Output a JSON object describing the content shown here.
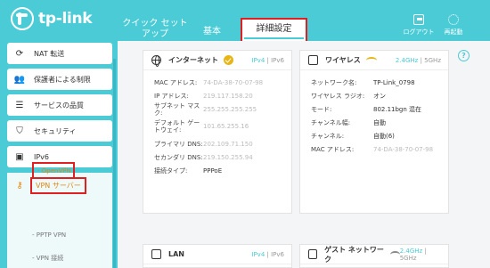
{
  "brand": {
    "name": "tp-link"
  },
  "header": {
    "tabs": [
      {
        "label": "クイック セット\nアップ"
      },
      {
        "label": "基本"
      },
      {
        "label": "詳細設定"
      }
    ],
    "logout_label": "ログアウト",
    "reboot_label": "再起動"
  },
  "sidebar": {
    "items": [
      {
        "label": "NAT 転送",
        "icon": "nat-icon"
      },
      {
        "label": "保護者による制限",
        "icon": "parental-icon"
      },
      {
        "label": "サービスの品質",
        "icon": "qos-icon"
      },
      {
        "label": "セキュリティ",
        "icon": "shield-icon"
      },
      {
        "label": "IPv6",
        "icon": "ipv6-icon"
      },
      {
        "label": "VPN サーバー",
        "icon": "key-icon"
      }
    ],
    "sub_items": [
      "- OpenVPN",
      "- PPTP VPN",
      "- VPN 接続"
    ]
  },
  "internet": {
    "title": "インターネット",
    "mode_ipv4": "IPv4",
    "sep": "|",
    "mode_ipv6": "IPv6",
    "rows": [
      {
        "label": "MAC アドレス:",
        "value": "74-DA-38-70-07-98"
      },
      {
        "label": "IP アドレス:",
        "value": "219.117.158.20"
      },
      {
        "label": "サブネット マスク:",
        "value": "255.255.255.255"
      },
      {
        "label": "デフォルト ゲートウェイ:",
        "value": "101.65.255.16"
      },
      {
        "label": "プライマリ DNS:",
        "value": "202.109.71.150"
      },
      {
        "label": "セカンダリ DNS:",
        "value": "219.150.255.94"
      },
      {
        "label": "接続タイプ:",
        "value": "PPPoE"
      }
    ]
  },
  "wireless": {
    "title": "ワイヤレス",
    "band1": "2.4GHz",
    "sep": "|",
    "band2": "5GHz",
    "rows": [
      {
        "label": "ネットワーク名:",
        "value": "TP-Link_0798"
      },
      {
        "label": "ワイヤレス ラジオ:",
        "value": "オン"
      },
      {
        "label": "モード:",
        "value": "802.11bgn 混在"
      },
      {
        "label": "チャンネル幅:",
        "value": "自動"
      },
      {
        "label": "チャンネル:",
        "value": "自動(6)"
      },
      {
        "label": "MAC アドレス:",
        "value": "74-DA-38-70-07-98"
      }
    ]
  },
  "lan": {
    "title": "LAN",
    "mode_ipv4": "IPv4",
    "sep": "|",
    "mode_ipv6": "IPv6"
  },
  "guest": {
    "title": "ゲスト ネットワーク",
    "band1": "2.4GHz",
    "sep": "|",
    "band2": "5GHz"
  },
  "colors": {
    "accent": "#4acbd6",
    "highlight": "#e02020",
    "active_text": "#e7850d"
  }
}
